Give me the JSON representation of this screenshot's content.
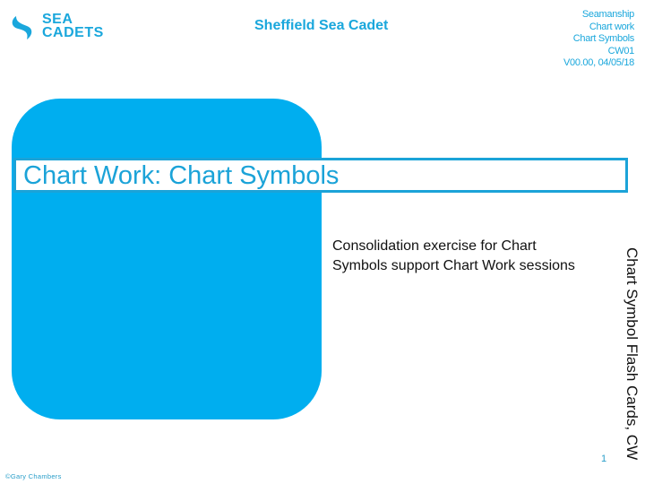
{
  "header": {
    "logo": {
      "icon": "sea-cadets-wave-icon",
      "line1": "SEA",
      "line2": "CADETS"
    },
    "org_title": "Sheffield Sea Cadet",
    "meta": [
      "Seamanship",
      "Chart work",
      "Chart Symbols",
      "CW01",
      "V00.00, 04/05/18"
    ]
  },
  "slide": {
    "title": "Chart Work: Chart Symbols",
    "description": "Consolidation exercise for Chart Symbols support Chart Work sessions",
    "side_label": "Chart Symbol Flash Cards, CW",
    "page_number": "1"
  },
  "footer": {
    "copyright": "©Gary Chambers"
  },
  "colors": {
    "brand_blue": "#00aeef",
    "accent_text": "#1ba3d8"
  }
}
